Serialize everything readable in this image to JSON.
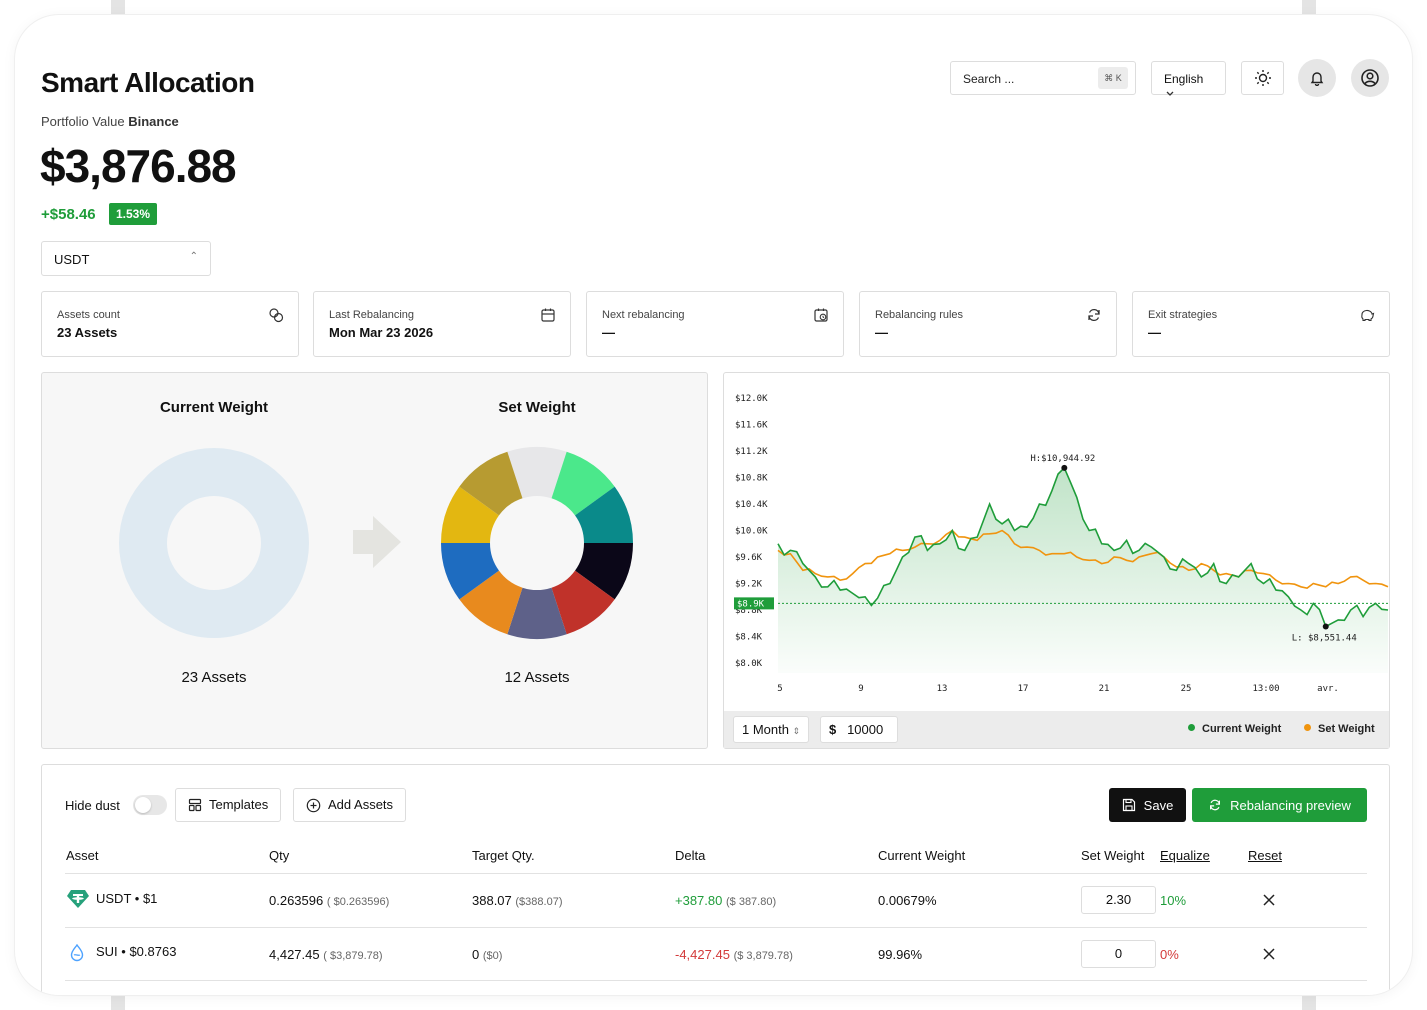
{
  "header": {
    "title": "Smart Allocation",
    "portfolio_label": "Portfolio Value",
    "portfolio_exchange": "Binance",
    "value": "$3,876.88",
    "gain": "+$58.46",
    "gain_pct": "1.53%",
    "currency": "USDT"
  },
  "topbar": {
    "search_placeholder": "Search ...",
    "search_shortcut": "⌘ K",
    "language": "English"
  },
  "cards": [
    {
      "label": "Assets count",
      "value": "23 Assets",
      "icon": "coins-icon"
    },
    {
      "label": "Last Rebalancing",
      "value": "Mon Mar 23 2026",
      "icon": "calendar-icon"
    },
    {
      "label": "Next rebalancing",
      "value": "—",
      "icon": "calendar-clock-icon"
    },
    {
      "label": "Rebalancing rules",
      "value": "—",
      "icon": "refresh-icon"
    },
    {
      "label": "Exit strategies",
      "value": "—",
      "icon": "piggy-bank-icon"
    }
  ],
  "weights": {
    "current": {
      "title": "Current Weight",
      "count": "23 Assets",
      "color": "#dfeaf2"
    },
    "set": {
      "title": "Set Weight",
      "count": "12 Assets",
      "slices": [
        {
          "color": "#e7e7e9",
          "value": 1
        },
        {
          "color": "#4be88b",
          "value": 1
        },
        {
          "color": "#0a8a8a",
          "value": 1
        },
        {
          "color": "#0b0718",
          "value": 1
        },
        {
          "color": "#c0322a",
          "value": 1
        },
        {
          "color": "#5e6189",
          "value": 1
        },
        {
          "color": "#e88a1e",
          "value": 1
        },
        {
          "color": "#1e6cc0",
          "value": 1
        },
        {
          "color": "#e3b711",
          "value": 1
        },
        {
          "color": "#b79b31",
          "value": 1
        }
      ]
    }
  },
  "chart_data": {
    "type": "line",
    "y_ticks": [
      "$12.0K",
      "$11.6K",
      "$11.2K",
      "$10.8K",
      "$10.4K",
      "$10.0K",
      "$9.6K",
      "$9.2K",
      "$8.8K",
      "$8.4K",
      "$8.0K"
    ],
    "x_ticks": [
      "5",
      "9",
      "13",
      "17",
      "21",
      "25",
      "13:00",
      "avr."
    ],
    "ylim": [
      8000,
      12000
    ],
    "current_value_label": "$8.9K",
    "current_value": 8900,
    "high_label": "H:$10,944.92",
    "low_label": "L: $8,551.44",
    "series": [
      {
        "name": "Current Weight",
        "color": "#1f9d3a",
        "values": [
          9800,
          9700,
          9500,
          9300,
          9150,
          9100,
          9050,
          9000,
          8980,
          9200,
          9600,
          9900,
          9700,
          9800,
          10000,
          9700,
          9900,
          10400,
          10100,
          10000,
          10050,
          10400,
          10600,
          10944.92,
          10500,
          10000,
          9800,
          9700,
          9850,
          9700,
          9750,
          9600,
          9400,
          9500,
          9300,
          9500,
          9200,
          9300,
          9500,
          9200,
          9100,
          9000,
          8800,
          8900,
          8551.44,
          8650,
          8800,
          8700,
          8900,
          8800
        ]
      },
      {
        "name": "Set Weight",
        "color": "#f0940e",
        "values": [
          9700,
          9650,
          9400,
          9350,
          9300,
          9250,
          9350,
          9500,
          9600,
          9650,
          9700,
          9750,
          9800,
          9850,
          10000,
          9900,
          9850,
          9950,
          10000,
          9800,
          9750,
          9700,
          9650,
          9650,
          9600,
          9550,
          9500,
          9600,
          9550,
          9600,
          9650,
          9600,
          9450,
          9400,
          9500,
          9400,
          9350,
          9300,
          9400,
          9350,
          9250,
          9200,
          9150,
          9200,
          9150,
          9200,
          9300,
          9250,
          9200,
          9150
        ]
      }
    ]
  },
  "chart_controls": {
    "period": "1 Month",
    "currency_symbol": "$",
    "amount": "10000",
    "legend_current": "Current Weight",
    "legend_set": "Set Weight"
  },
  "table": {
    "hide_dust": "Hide dust",
    "templates": "Templates",
    "add_assets": "Add Assets",
    "save": "Save",
    "rebalancing_preview": "Rebalancing preview",
    "headers": {
      "asset": "Asset",
      "qty": "Qty",
      "target_qty": "Target Qty.",
      "delta": "Delta",
      "current_weight": "Current Weight",
      "set_weight": "Set Weight",
      "equalize": "Equalize",
      "reset": "Reset"
    },
    "rows": [
      {
        "asset": "USDT",
        "price": "$1",
        "qty": "0.263596",
        "qty_usd": "( $0.263596)",
        "target": "388.07",
        "target_usd": "($388.07)",
        "delta": "+387.80",
        "delta_usd": "($ 387.80)",
        "delta_color": "#1f9d3a",
        "current_weight": "0.00679%",
        "set_value": "2.30",
        "set_pct": "10%",
        "set_pct_color": "#1f9d3a"
      },
      {
        "asset": "SUI",
        "price": "$0.8763",
        "qty": "4,427.45",
        "qty_usd": "( $3,879.78)",
        "target": "0",
        "target_usd": "($0)",
        "delta": "-4,427.45",
        "delta_usd": "($ 3,879.78)",
        "delta_color": "#d33a3a",
        "current_weight": "99.96%",
        "set_value": "0",
        "set_pct": "0%",
        "set_pct_color": "#d33a3a"
      }
    ]
  }
}
